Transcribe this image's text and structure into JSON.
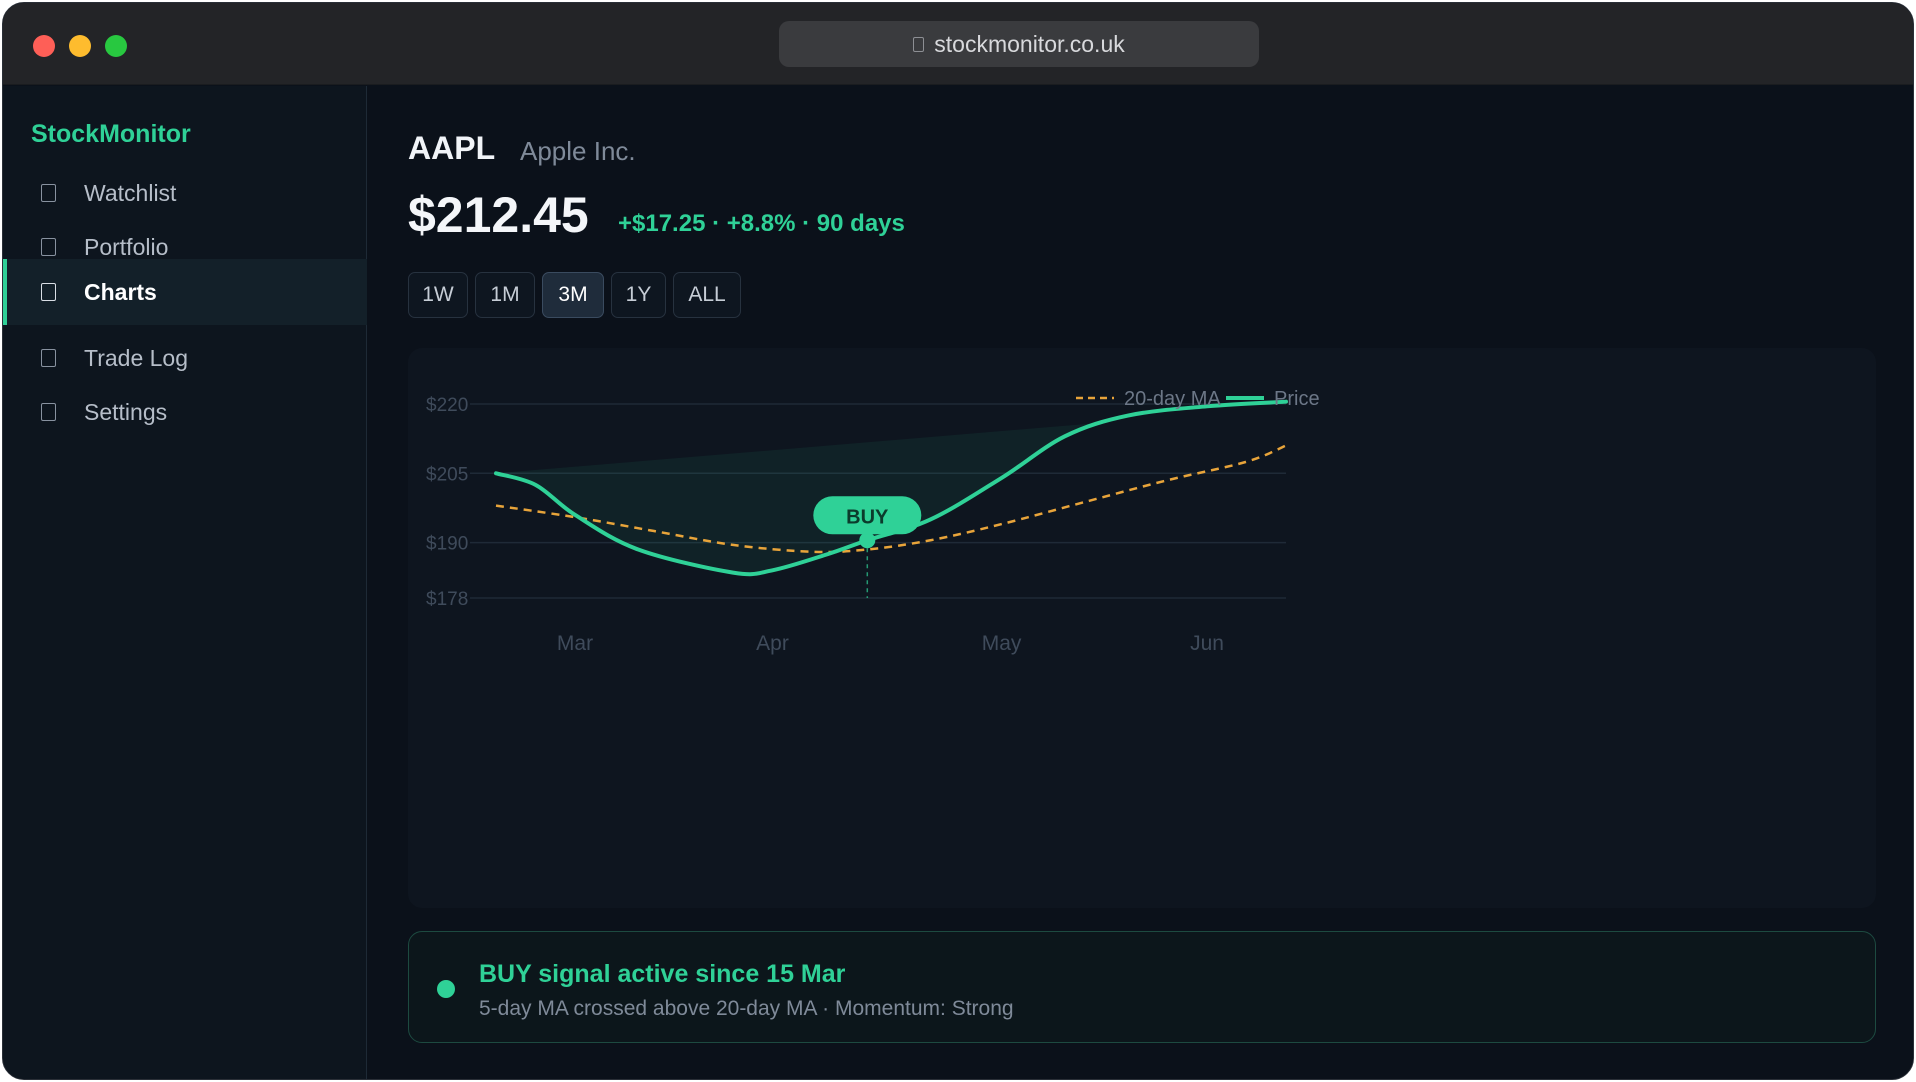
{
  "browser": {
    "url": "stockmonitor.co.uk"
  },
  "sidebar": {
    "brand": "StockMonitor",
    "items": [
      {
        "label": "Watchlist",
        "active": false
      },
      {
        "label": "Portfolio",
        "active": false
      },
      {
        "label": "Charts",
        "active": true
      },
      {
        "label": "Trade Log",
        "active": false
      },
      {
        "label": "Settings",
        "active": false
      }
    ]
  },
  "header": {
    "ticker": "AAPL",
    "company": "Apple Inc.",
    "price": "$212.45",
    "change": "+$17.25 · +8.8% · 90 days"
  },
  "ranges": [
    "1W",
    "1M",
    "3M",
    "1Y",
    "ALL"
  ],
  "active_range": "3M",
  "chart_data": {
    "type": "line",
    "y_ticks": [
      "$220",
      "$205",
      "$190",
      "$178"
    ],
    "y_tick_values": [
      220,
      205,
      190,
      178
    ],
    "ylim": [
      178,
      220
    ],
    "x_ticks": [
      "Mar",
      "Apr",
      "May",
      "Jun"
    ],
    "x_tick_positions": [
      0.1,
      0.35,
      0.64,
      0.9
    ],
    "grid": true,
    "legend_placement": "top-right",
    "legend": [
      "20-day MA",
      "Price"
    ],
    "series": [
      {
        "name": "Price",
        "color": "#2fd197",
        "x": [
          0,
          0.05,
          0.1,
          0.18,
          0.3,
          0.35,
          0.42,
          0.47,
          0.55,
          0.64,
          0.72,
          0.8,
          0.9,
          1.0
        ],
        "values": [
          205,
          202.5,
          196,
          188.5,
          183.5,
          184,
          187.5,
          190.5,
          195,
          204,
          213,
          217.5,
          219.5,
          220.5
        ]
      },
      {
        "name": "20-day MA",
        "color": "#e8a43a",
        "dashed": true,
        "x": [
          0,
          0.1,
          0.2,
          0.3,
          0.4,
          0.47,
          0.55,
          0.64,
          0.75,
          0.85,
          0.95,
          1.0
        ],
        "values": [
          198,
          195.5,
          192.5,
          189.5,
          188,
          188.5,
          190.5,
          194,
          199,
          203.5,
          207.5,
          211
        ]
      }
    ],
    "annotation": {
      "label": "BUY",
      "x": 0.47,
      "value": 190.5,
      "color": "#2fd197"
    }
  },
  "signal": {
    "title": "BUY signal active since 15 Mar",
    "subtitle": "5-day MA crossed above 20-day MA · Momentum: Strong"
  }
}
